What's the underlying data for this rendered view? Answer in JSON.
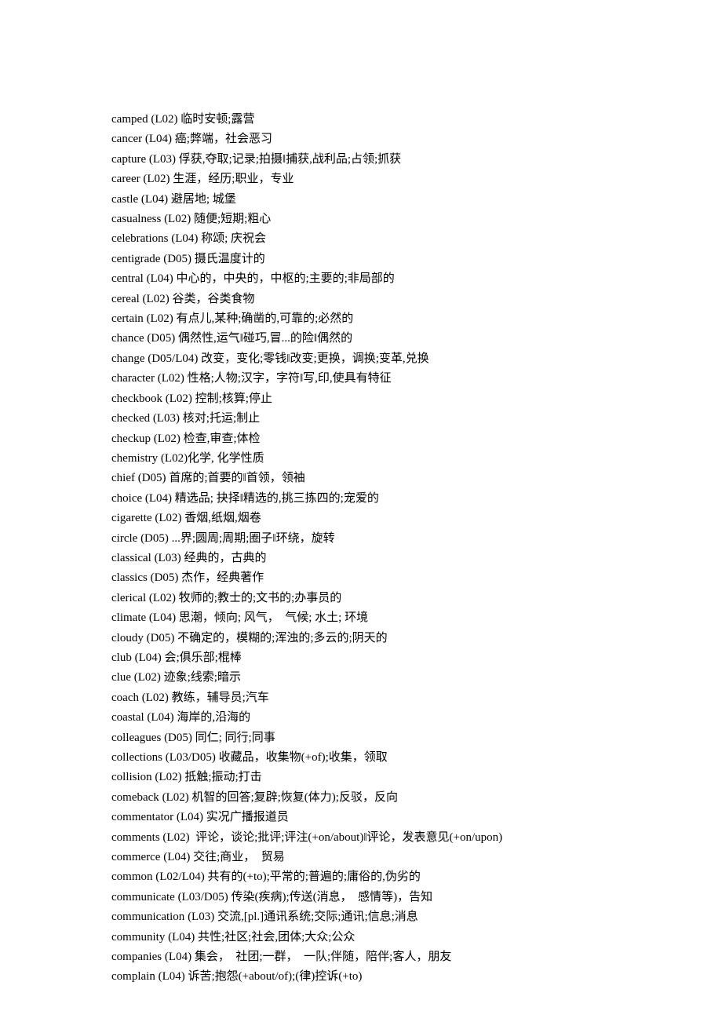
{
  "entries": [
    {
      "word": "camped",
      "code": "(L02)",
      "def": "临时安顿;露营"
    },
    {
      "word": "cancer",
      "code": "(L04)",
      "def": "癌;弊端，社会恶习"
    },
    {
      "word": "capture",
      "code": "(L03)",
      "def": "俘获,夺取;记录;拍摄‖捕获,战利品;占领;抓获"
    },
    {
      "word": "career",
      "code": "(L02)",
      "def": "生涯，经历;职业，专业"
    },
    {
      "word": "castle",
      "code": "(L04)",
      "def": "避居地; 城堡"
    },
    {
      "word": "casualness",
      "code": "(L02)",
      "def": "随便;短期;粗心"
    },
    {
      "word": "celebrations",
      "code": "(L04)",
      "def": "称颂; 庆祝会"
    },
    {
      "word": "centigrade",
      "code": "(D05)",
      "def": "摄氏温度计的"
    },
    {
      "word": "central",
      "code": "(L04)",
      "def": "中心的，中央的，中枢的;主要的;非局部的"
    },
    {
      "word": "cereal",
      "code": "(L02)",
      "def": "谷类，谷类食物"
    },
    {
      "word": "certain",
      "code": "(L02)",
      "def": "有点儿,某种;确凿的,可靠的;必然的"
    },
    {
      "word": "chance",
      "code": "(D05)",
      "def": "偶然性,运气‖碰巧,冒...的险‖偶然的"
    },
    {
      "word": "change",
      "code": "(D05/L04)",
      "def": "改变，变化;零钱‖改变;更换，调换;变革,兑换"
    },
    {
      "word": "character",
      "code": "(L02)",
      "def": "性格;人物;汉字，字符‖写,印,使具有特征"
    },
    {
      "word": "checkbook",
      "code": "(L02)",
      "def": "控制;核算;停止"
    },
    {
      "word": "checked",
      "code": "(L03)",
      "def": "核对;托运;制止"
    },
    {
      "word": "checkup",
      "code": "(L02)",
      "def": "检查,审查;体检"
    },
    {
      "word": "chemistry",
      "code": "(L02)化学,",
      "def": "化学性质"
    },
    {
      "word": "chief",
      "code": "(D05)",
      "def": "首席的;首要的‖首领，领袖"
    },
    {
      "word": "choice",
      "code": "(L04)",
      "def": "精选品; 抉择‖精选的,挑三拣四的;宠爱的"
    },
    {
      "word": "cigarette",
      "code": "(L02)",
      "def": "香烟,纸烟,烟卷"
    },
    {
      "word": "circle",
      "code": "(D05)",
      "def": "...界;圆周;周期;圈子‖环绕，旋转"
    },
    {
      "word": "classical",
      "code": "(L03)",
      "def": "经典的，古典的"
    },
    {
      "word": "classics",
      "code": "(D05)",
      "def": "杰作，经典著作"
    },
    {
      "word": "clerical",
      "code": "(L02)",
      "def": "牧师的;教士的;文书的;办事员的"
    },
    {
      "word": "climate",
      "code": "(L04)",
      "def": "思潮，倾向; 风气，  气候; 水土; 环境"
    },
    {
      "word": "cloudy",
      "code": "(D05)",
      "def": "不确定的，模糊的;浑浊的;多云的;阴天的"
    },
    {
      "word": "club",
      "code": "(L04)",
      "def": "会;俱乐部;棍棒"
    },
    {
      "word": "clue",
      "code": "(L02)",
      "def": "迹象;线索;暗示"
    },
    {
      "word": "coach",
      "code": "(L02)",
      "def": "教练，辅导员;汽车"
    },
    {
      "word": "coastal",
      "code": "(L04)",
      "def": "海岸的,沿海的"
    },
    {
      "word": "colleagues",
      "code": "(D05)",
      "def": "同仁; 同行;同事"
    },
    {
      "word": "collections",
      "code": "(L03/D05)",
      "def": "收藏品，收集物(+of);收集，领取"
    },
    {
      "word": "collision",
      "code": "(L02)",
      "def": "抵触;振动;打击"
    },
    {
      "word": "comeback",
      "code": "(L02)",
      "def": "机智的回答;复辟;恢复(体力);反驳，反向"
    },
    {
      "word": "commentator",
      "code": "(L04)",
      "def": "实况广播报道员"
    },
    {
      "word": "comments",
      "code": "(L02)",
      "def": " 评论，谈论;批评;评注(+on/about)‖评论，发表意见(+on/upon)"
    },
    {
      "word": "commerce",
      "code": "(L04)",
      "def": "交往;商业，  贸易"
    },
    {
      "word": "common",
      "code": "(L02/L04)",
      "def": "共有的(+to);平常的;普遍的;庸俗的,伪劣的"
    },
    {
      "word": "communicate",
      "code": "(L03/D05)",
      "def": "传染(疾病);传送(消息，  感情等)，告知"
    },
    {
      "word": "communication",
      "code": "(L03)",
      "def": "交流,[pl.]通讯系统;交际;通讯;信息;消息"
    },
    {
      "word": "community",
      "code": "(L04)",
      "def": "共性;社区;社会,团体;大众;公众"
    },
    {
      "word": "companies",
      "code": "(L04)",
      "def": "集会，  社团;一群，  一队;伴随，陪伴;客人，朋友"
    },
    {
      "word": "complain",
      "code": "(L04)",
      "def": "诉苦;抱怨(+about/of);(律)控诉(+to)"
    }
  ]
}
